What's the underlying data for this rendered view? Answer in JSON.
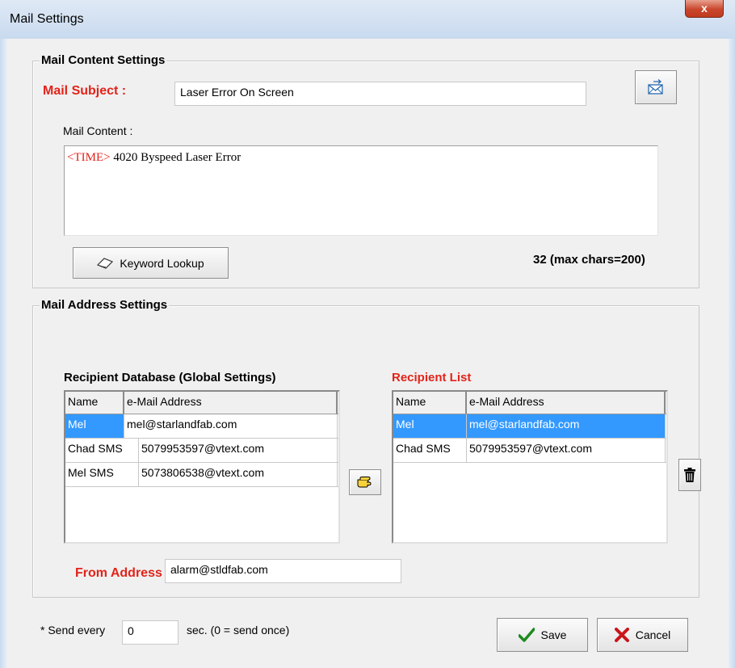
{
  "window": {
    "title": "Mail Settings",
    "close_label": "x"
  },
  "content_group": {
    "legend": "Mail Content Settings",
    "subject_label": "Mail Subject :",
    "subject_value": "Laser Error On Screen",
    "content_label": "Mail Content :",
    "content_keyword": "<TIME>",
    "content_text": " 4020 Byspeed  Laser Error",
    "keyword_button": "Keyword Lookup",
    "char_count": "32 (max chars=200)",
    "send_test_icon": "mail-send-icon"
  },
  "address_group": {
    "legend": "Mail Address Settings",
    "database_title": "Recipient Database (Global Settings)",
    "recipient_title": "Recipient List",
    "columns": [
      "Name",
      "e-Mail Address"
    ],
    "database_rows": [
      {
        "name": "Mel",
        "email": "mel@starlandfab.com"
      },
      {
        "name": "Chad SMS",
        "email": "5079953597@vtext.com"
      },
      {
        "name": "Mel SMS",
        "email": "5073806538@vtext.com"
      }
    ],
    "recipient_rows": [
      {
        "name": "Mel",
        "email": "mel@starlandfab.com"
      },
      {
        "name": "Chad SMS",
        "email": "5079953597@vtext.com"
      }
    ],
    "add_icon": "pointing-hand-icon",
    "delete_icon": "trash-icon",
    "from_label": "From Address",
    "from_value": "alarm@stldfab.com"
  },
  "footer": {
    "send_every_label": "* Send every",
    "send_every_value": "0",
    "send_every_suffix": "sec. (0 = send once)",
    "save_label": "Save",
    "cancel_label": "Cancel"
  }
}
